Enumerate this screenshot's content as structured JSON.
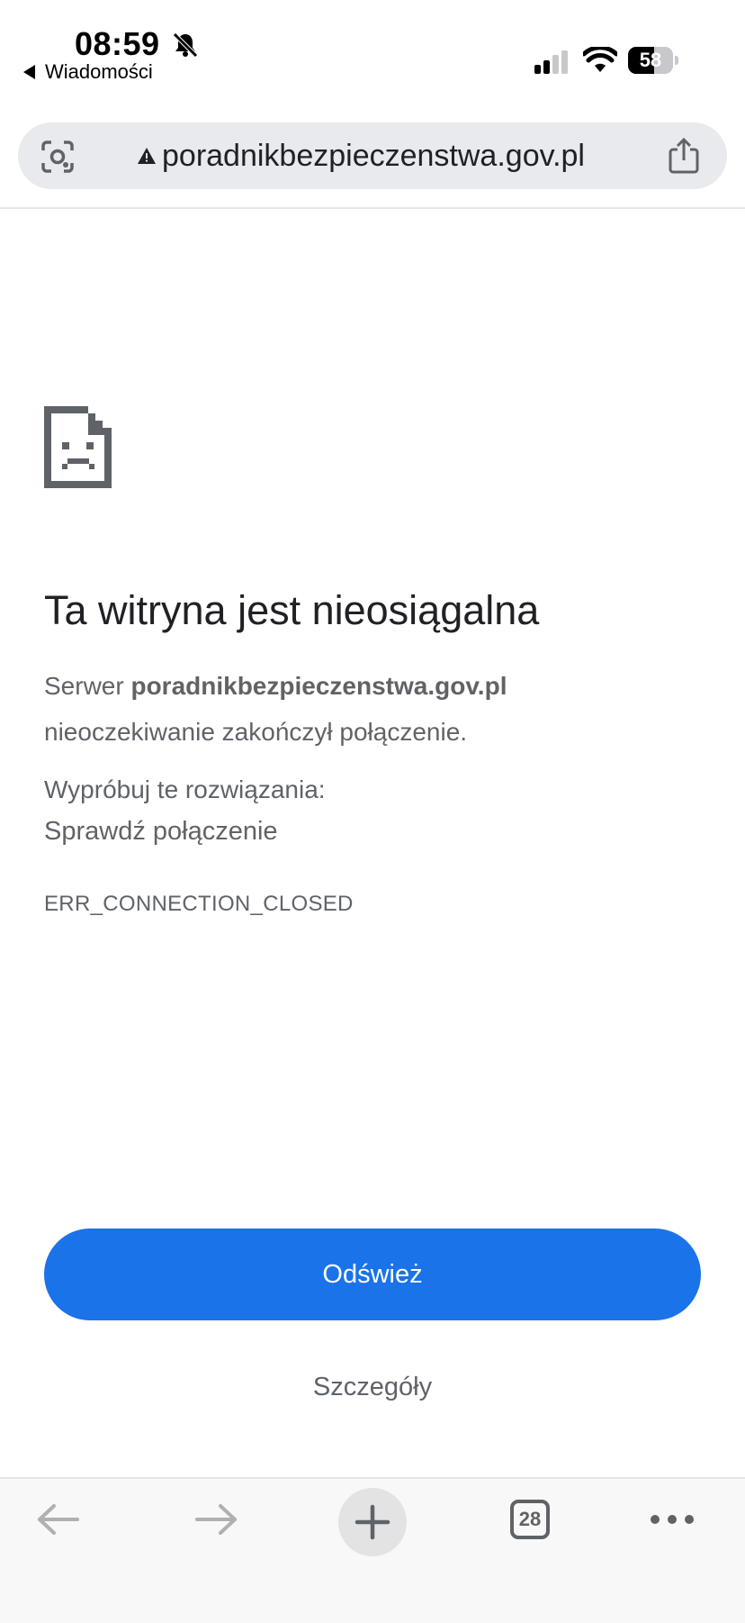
{
  "status_bar": {
    "time": "08:59",
    "back_app_label": "Wiadomości",
    "battery_percent": "58",
    "battery_level": 0.58
  },
  "address_bar": {
    "url": "poradnikbezpieczenstwa.gov.pl"
  },
  "error_page": {
    "title": "Ta witryna jest nieosiągalna",
    "server_prefix": "Serwer ",
    "server_host": "poradnikbezpieczenstwa.gov.pl",
    "message_line2": "nieoczekiwanie zakończył połączenie.",
    "try_label": "Wypróbuj te rozwiązania:",
    "suggestion": "Sprawdź połączenie",
    "error_code": "ERR_CONNECTION_CLOSED",
    "refresh_label": "Odśwież",
    "details_label": "Szczegóły"
  },
  "toolbar": {
    "tab_count": "28"
  },
  "colors": {
    "accent": "#1a73e8",
    "text_primary": "#202124",
    "text_secondary": "#5f6368",
    "address_bar_bg": "#e8eaed"
  },
  "icons": {
    "status": [
      "bell-slash-icon",
      "back-triangle-icon",
      "signal-icon",
      "wifi-icon",
      "battery-icon"
    ],
    "address_bar": [
      "lens-icon",
      "warning-icon",
      "share-icon"
    ],
    "content": [
      "sad-page-icon"
    ],
    "toolbar": [
      "back-arrow-icon",
      "forward-arrow-icon",
      "plus-icon",
      "tabs-icon",
      "more-icon"
    ]
  }
}
